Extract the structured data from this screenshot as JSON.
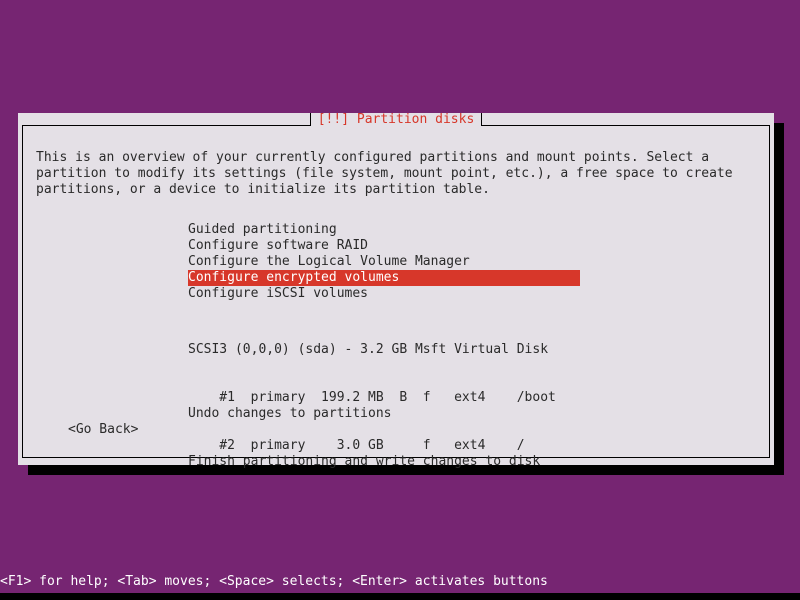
{
  "screen": {
    "background_color": "#762572",
    "accent_red": "#d7372a",
    "dialog_background": "#e4e0e6",
    "text_color": "#2a2a2a",
    "shadow_color": "#000000"
  },
  "dialog": {
    "title": "[!!] Partition disks",
    "intro_lines": [
      "This is an overview of your currently configured partitions and mount points. Select a",
      "partition to modify its settings (file system, mount point, etc.), a free space to create",
      "partitions, or a device to initialize its partition table."
    ],
    "menu_items": [
      {
        "label": "Guided partitioning",
        "selected": false
      },
      {
        "label": "Configure software RAID",
        "selected": false
      },
      {
        "label": "Configure the Logical Volume Manager",
        "selected": false
      },
      {
        "label": "Configure encrypted volumes",
        "selected": true
      },
      {
        "label": "Configure iSCSI volumes",
        "selected": false
      }
    ],
    "disk": {
      "header": "SCSI3 (0,0,0) (sda) - 3.2 GB Msft Virtual Disk",
      "partitions": [
        "    #1  primary  199.2 MB  B  f   ext4    /boot",
        "    #2  primary    3.0 GB     f   ext4    /"
      ]
    },
    "actions": [
      "Undo changes to partitions",
      "Finish partitioning and write changes to disk"
    ],
    "buttons": {
      "go_back": "<Go Back>"
    }
  },
  "status_bar": {
    "text": "<F1> for help; <Tab> moves; <Space> selects; <Enter> activates buttons"
  }
}
